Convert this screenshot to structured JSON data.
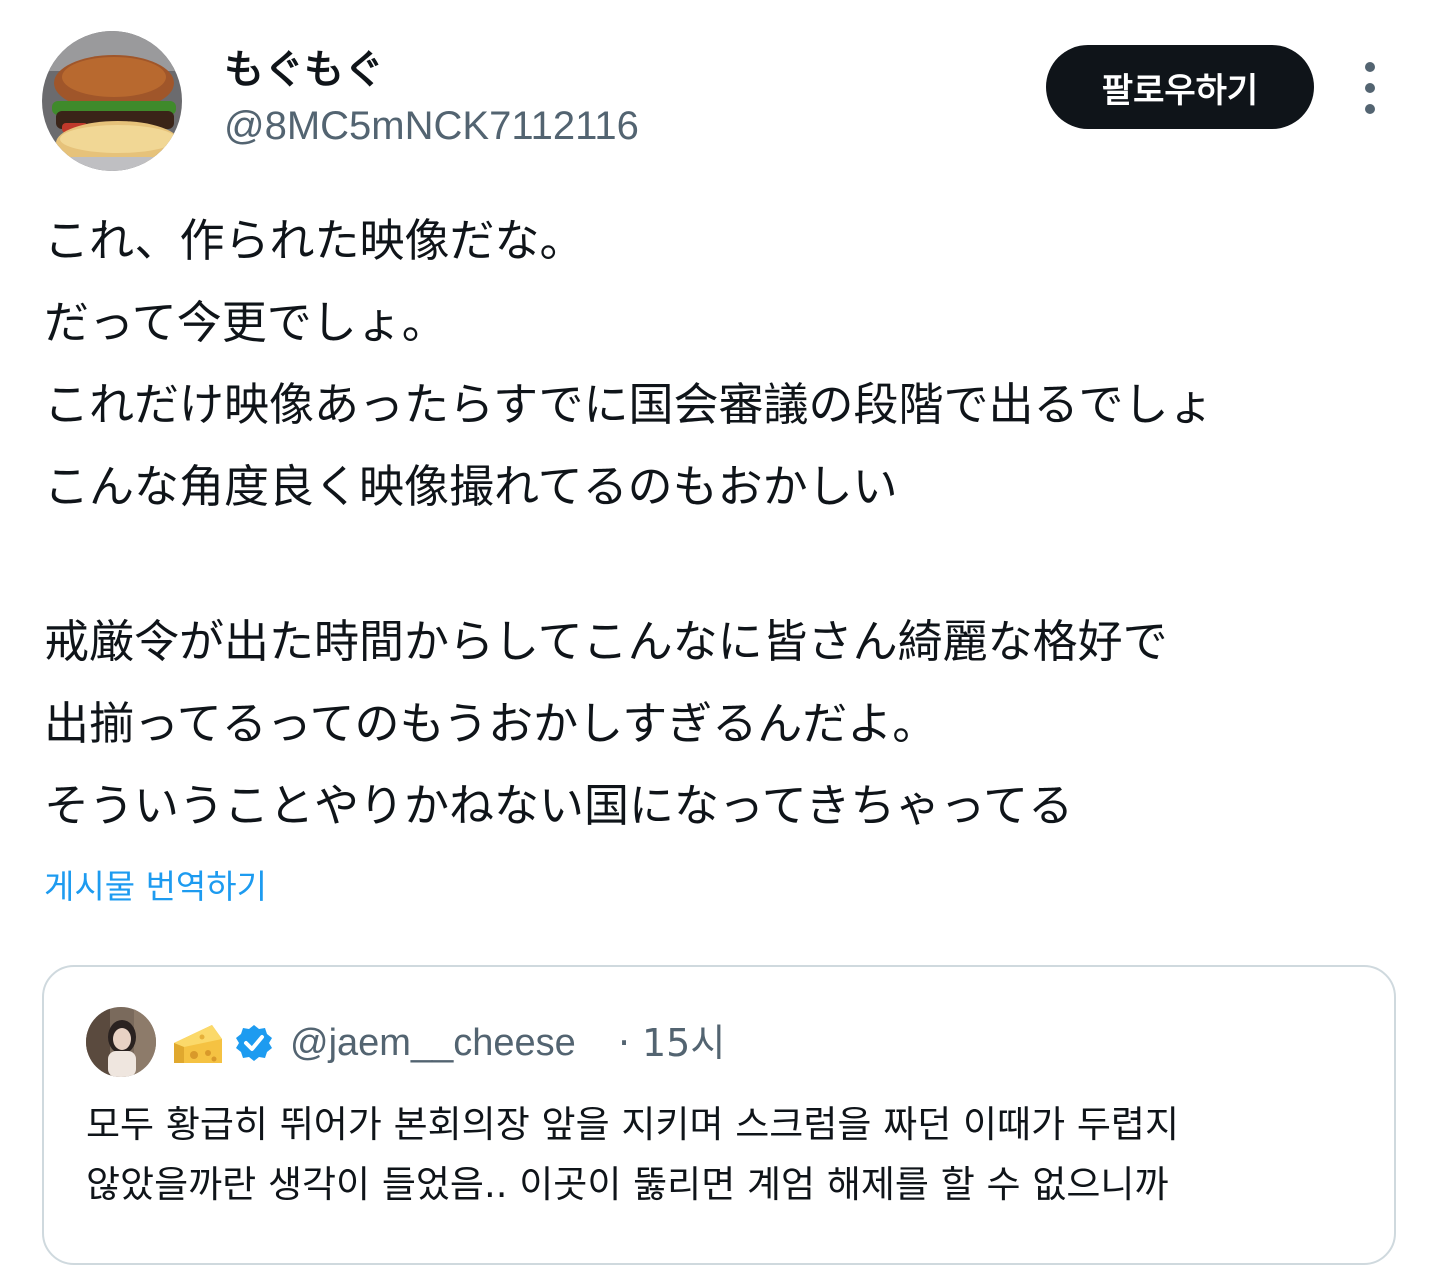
{
  "author": {
    "display_name": "もぐもぐ",
    "handle": "@8MC5mNCK7112116",
    "avatar_icon": "hamburger-avatar"
  },
  "follow_button": {
    "label": "팔로우하기"
  },
  "more_icon": "more-vertical-icon",
  "tweet": {
    "lines": [
      "これ、作られた映像だな。",
      "だって今更でしょ。",
      "これだけ映像あったらすでに国会審議の段階で出るでしょ",
      "こんな角度良く映像撮れてるのもおかしい",
      "",
      "戒厳令が出た時間からしてこんなに皆さん綺麗な格好で",
      "出揃ってるってのもうおかしすぎるんだよ。",
      "そういうことやりかねない国になってきちゃってる"
    ]
  },
  "translate_link": "게시물 번역하기",
  "quoted_post": {
    "avatar_icon": "person-photo-avatar",
    "emoji_icon": "cheese-icon",
    "verified_icon": "verified-badge-icon",
    "handle": "@jaem__cheese",
    "separator": "·",
    "time": "15시",
    "lines": [
      "모두 황급히 뛰어가 본회의장 앞을 지키며 스크럼을 짜던 이때가 두렵지",
      "않았을까란 생각이 들었음.. 이곳이 뚫리면 계엄 해제를 할 수 없으니까"
    ]
  },
  "colors": {
    "text": "#0f1419",
    "secondary": "#536471",
    "link": "#1d9bf0",
    "button_bg": "#0f1419",
    "border": "#cfd9de",
    "verified": "#1d9bf0"
  }
}
